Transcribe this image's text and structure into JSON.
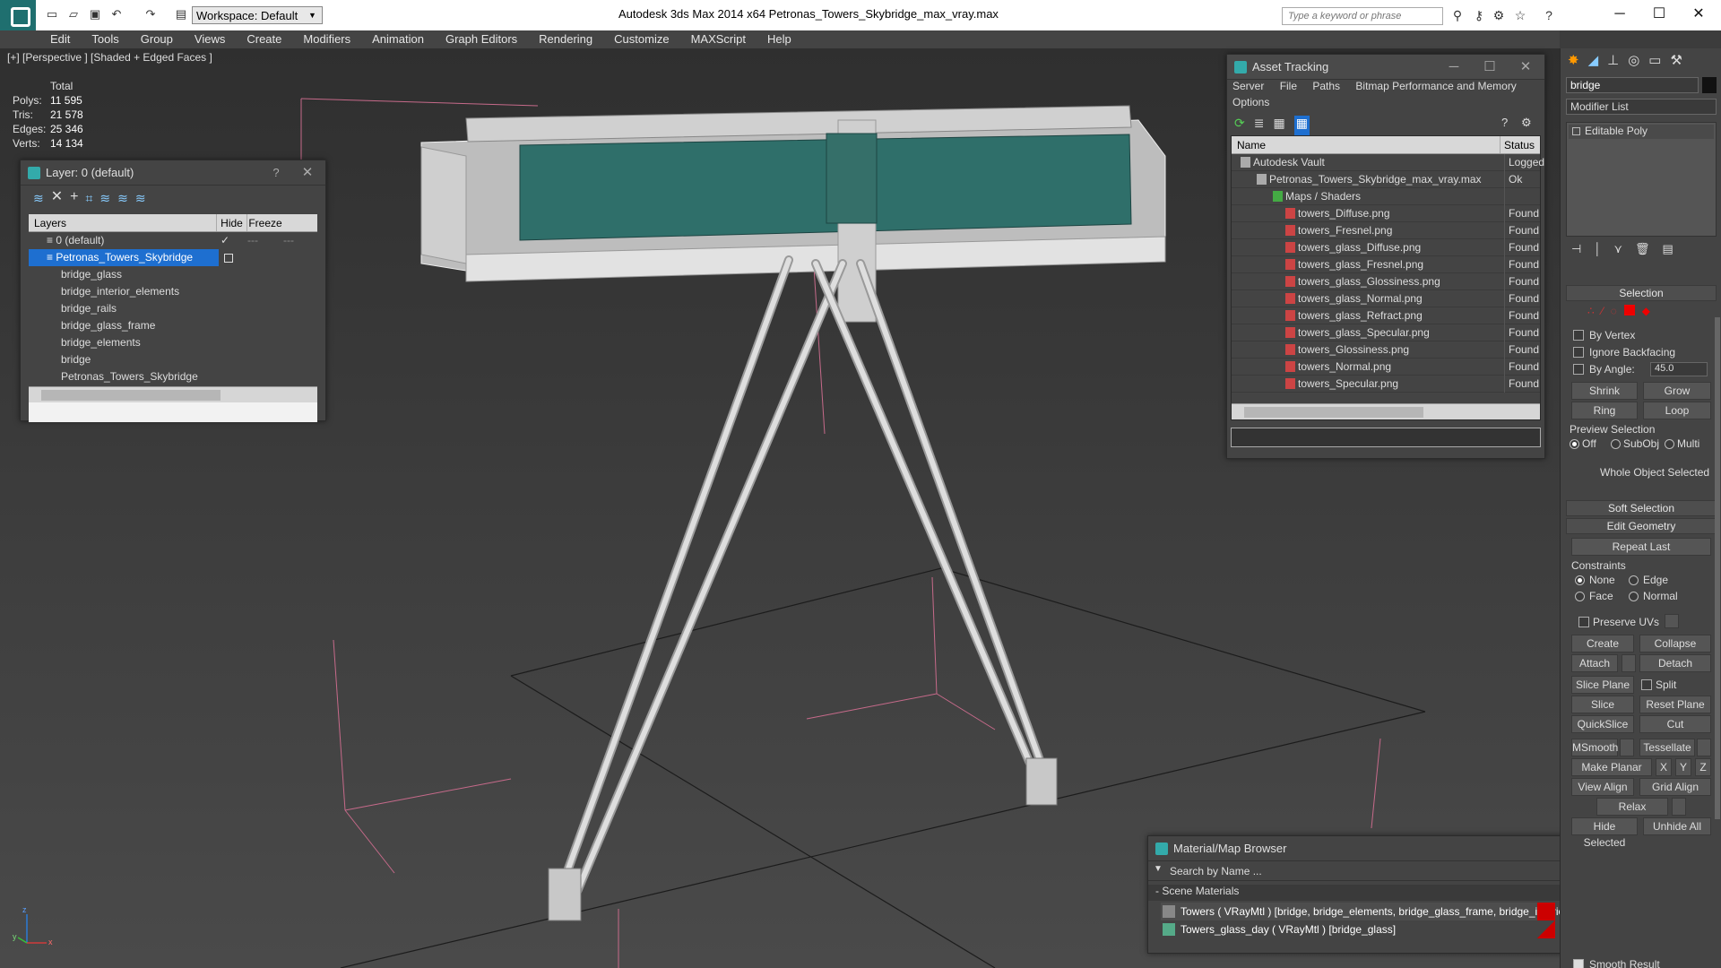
{
  "app": {
    "title": "Autodesk 3ds Max  2014 x64     Petronas_Towers_Skybridge_max_vray.max",
    "workspace": "Workspace: Default",
    "search_placeholder": "Type a keyword or phrase"
  },
  "menu": [
    "Edit",
    "Tools",
    "Group",
    "Views",
    "Create",
    "Modifiers",
    "Animation",
    "Graph Editors",
    "Rendering",
    "Customize",
    "MAXScript",
    "Help"
  ],
  "viewport": {
    "label": "[+] [Perspective ] [Shaded + Edged Faces ]",
    "stats": {
      "header": "Total",
      "polys_label": "Polys:",
      "polys": "11 595",
      "tris_label": "Tris:",
      "tris": "21 578",
      "edges_label": "Edges:",
      "edges": "25 346",
      "verts_label": "Verts:",
      "verts": "14 134"
    },
    "axis": {
      "x": "x",
      "y": "y",
      "z": "z"
    }
  },
  "layer_panel": {
    "title": "Layer: 0 (default)",
    "help": "?",
    "cols": {
      "layers": "Layers",
      "hide": "Hide",
      "freeze": "Freeze"
    },
    "rows": [
      "0 (default)",
      "Petronas_Towers_Skybridge",
      "bridge_glass",
      "bridge_interior_elements",
      "bridge_rails",
      "bridge_glass_frame",
      "bridge_elements",
      "bridge",
      "Petronas_Towers_Skybridge"
    ]
  },
  "asset_tracking": {
    "title": "Asset Tracking",
    "menu1": [
      "Server",
      "File",
      "Paths",
      "Bitmap Performance and Memory"
    ],
    "menu2": "Options",
    "cols": {
      "name": "Name",
      "status": "Status"
    },
    "rows": [
      {
        "name": "Autodesk Vault",
        "status": "Logged"
      },
      {
        "name": "Petronas_Towers_Skybridge_max_vray.max",
        "status": "Ok"
      },
      {
        "name": "Maps / Shaders",
        "status": ""
      },
      {
        "name": "towers_Diffuse.png",
        "status": "Found"
      },
      {
        "name": "towers_Fresnel.png",
        "status": "Found"
      },
      {
        "name": "towers_glass_Diffuse.png",
        "status": "Found"
      },
      {
        "name": "towers_glass_Fresnel.png",
        "status": "Found"
      },
      {
        "name": "towers_glass_Glossiness.png",
        "status": "Found"
      },
      {
        "name": "towers_glass_Normal.png",
        "status": "Found"
      },
      {
        "name": "towers_glass_Refract.png",
        "status": "Found"
      },
      {
        "name": "towers_glass_Specular.png",
        "status": "Found"
      },
      {
        "name": "towers_Glossiness.png",
        "status": "Found"
      },
      {
        "name": "towers_Normal.png",
        "status": "Found"
      },
      {
        "name": "towers_Specular.png",
        "status": "Found"
      }
    ]
  },
  "material_browser": {
    "title": "Material/Map Browser",
    "search": "Search by Name ...",
    "section": "- Scene Materials",
    "items": [
      "Towers ( VRayMtl ) [bridge, bridge_elements, bridge_glass_frame, bridge_interior_elements, bridge_rails]",
      "Towers_glass_day ( VRayMtl ) [bridge_glass]"
    ]
  },
  "command_panel": {
    "object_name": "bridge",
    "modifier_list": "Modifier List",
    "stack_item": "Editable Poly",
    "selection": "Selection",
    "by_vertex": "By Vertex",
    "ignore_backfacing": "Ignore Backfacing",
    "by_angle": "By Angle:",
    "angle": "45.0",
    "shrink": "Shrink",
    "grow": "Grow",
    "ring": "Ring",
    "loop": "Loop",
    "preview_selection": "Preview Selection",
    "off": "Off",
    "subobj": "SubObj",
    "multi": "Multi",
    "whole_object": "Whole Object Selected",
    "soft_selection": "Soft Selection",
    "edit_geometry": "Edit Geometry",
    "repeat_last": "Repeat Last",
    "constraints": "Constraints",
    "none": "None",
    "edge": "Edge",
    "face": "Face",
    "normal": "Normal",
    "preserve_uvs": "Preserve UVs",
    "create": "Create",
    "collapse": "Collapse",
    "attach": "Attach",
    "detach": "Detach",
    "slice_plane": "Slice Plane",
    "split": "Split",
    "slice": "Slice",
    "reset_plane": "Reset Plane",
    "quickslice": "QuickSlice",
    "cut": "Cut",
    "msmooth": "MSmooth",
    "tessellate": "Tessellate",
    "make_planar": "Make Planar",
    "x": "X",
    "y": "Y",
    "z": "Z",
    "view_align": "View Align",
    "grid_align": "Grid Align",
    "relax": "Relax",
    "hide_selected": "Hide Selected",
    "unhide_all": "Unhide All",
    "smooth_result": "Smooth Result"
  },
  "colors": {
    "glass": "#2f6f6a",
    "wire": "#c8c8c8",
    "grid": "#1e1e1e",
    "selection": "#1e6fd0"
  }
}
